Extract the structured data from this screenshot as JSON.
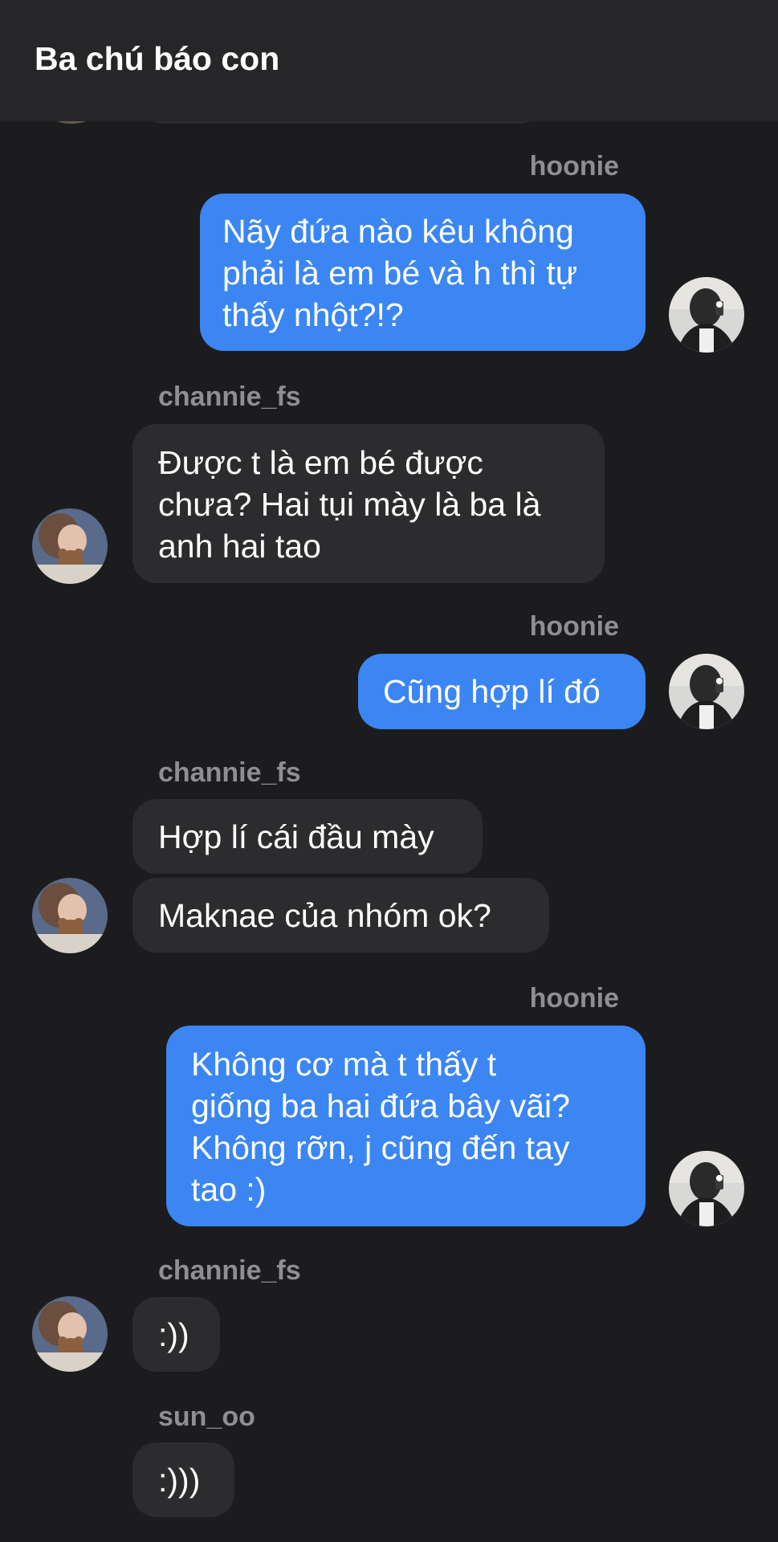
{
  "header": {
    "title": "Ba chú báo con"
  },
  "messages": [
    {
      "sender": "hoonie",
      "text": "Nãy đứa nào kêu không\nphải là em bé và h thì tự\nthấy nhột?!?"
    },
    {
      "sender": "channie_fs",
      "text": "Được t là em bé được\nchưa? Hai tụi mày là ba là\nanh hai tao"
    },
    {
      "sender": "hoonie",
      "text": "Cũng hợp lí đó"
    },
    {
      "sender": "channie_fs",
      "text": "Hợp lí cái đầu mày"
    },
    {
      "text": "Maknae của nhóm ok?"
    },
    {
      "sender": "hoonie",
      "text": "Không cơ mà t thấy t\ngiống ba hai đứa bây vãi?\nKhông rỡn, j cũng đến tay\ntao :)"
    },
    {
      "sender": "channie_fs",
      "text": ":))"
    },
    {
      "sender": "sun_oo",
      "text": ":)))"
    }
  ],
  "colors": {
    "background": "#1c1c1e",
    "header": "#262628",
    "outgoing_bubble": "#3b86f2",
    "incoming_bubble": "#2c2c2e",
    "sender_name": "#8e8e93"
  }
}
